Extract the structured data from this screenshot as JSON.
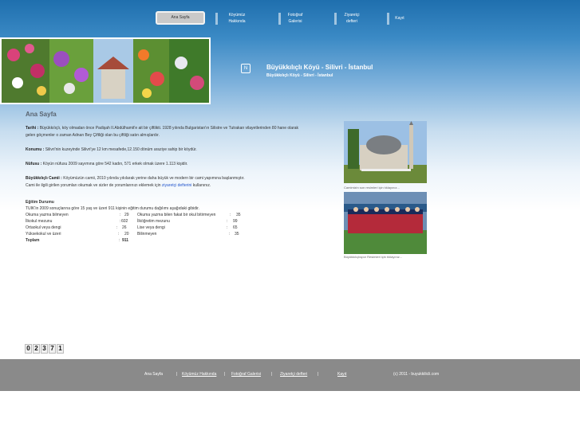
{
  "nav": {
    "items": [
      {
        "label": "Ana Sayfa"
      },
      {
        "label": "Köyümüz Hakkında"
      },
      {
        "label": "Fotoğraf Galerisi"
      },
      {
        "label": "Ziyaretçi defteri"
      },
      {
        "label": "Kayıt"
      }
    ]
  },
  "header": {
    "title": "Büyükkılıçlı Köyü - Silivri - İstanbul",
    "subtitle": "Büyükkılıçlı Köyü - Silivri - İstanbul",
    "icon": "site-icon"
  },
  "main": {
    "page_title": "Ana Sayfa",
    "sections": [
      {
        "label": "Tarihi :",
        "text": "Büyükkılıçlı, köy olmadan önce Padişah II.Abdülhamit'e ait bir çiftlikti. 1928 yılında Bulgaristan'ın Silistre ve Tutrakan vilayetlerinden 80 hane olarak gelen göçmenler o zaman Adnan Bey Çiftliği olan bu çiftliği satın almışlardır."
      },
      {
        "label": "Konumu :",
        "text": "Silivri'nin kuzeyinde Silivri'ye 12 km mesafede,12.150 dönüm araziye sahip bir köydür."
      },
      {
        "label": "Nüfusu :",
        "text": "Köyün nüfusu 2009 sayımına göre 542 kadın, 571 erkek olmak üzere 1.113 kişidir."
      },
      {
        "label": "Büyükkılıçlı Camii :",
        "text": "Köyümüzün camii, 2010 yılında yıkılarak yerine daha büyük ve modern bir cami yapımına başlanmıştır.",
        "text2": "Cami ile ilgili girilen yorumları okumak ve sizler de yorumlarınızı eklemek için",
        "link": "ziyaretçi defterini",
        "text3": "kullanınız."
      }
    ],
    "education": {
      "title": "Eğitim Durumu",
      "intro": "TUIK'in 2009 sonuçlarına göre 15 yaş ve üzeri 911 kişinin eğitim durumu dağılımı aşağıdaki gibidir.",
      "left": [
        {
          "label": "Okuma yazma bilmeyen",
          "value": "29"
        },
        {
          "label": "İlkokul mezunu",
          "value": "602"
        },
        {
          "label": "Ortaokul veya dengi",
          "value": "26"
        },
        {
          "label": "Yüksekokul ve üzeri",
          "value": "20"
        },
        {
          "label": "Toplam",
          "value": "911"
        }
      ],
      "right": [
        {
          "label": "Okuma yazma bilen fakat bir okul bitirmeyen",
          "value": "35"
        },
        {
          "label": "İlköğretim mezunu",
          "value": "99"
        },
        {
          "label": "Lise veya dengi",
          "value": "65"
        },
        {
          "label": "Bilinmeyen",
          "value": "35"
        }
      ]
    }
  },
  "sidebar": {
    "photo1_caption": "Camimizin son resimleri için tıklayınız...",
    "photo2_caption": "Büyükkılıçlıspor Resimleri için tıklayınız..."
  },
  "counter": {
    "digits": [
      "0",
      "2",
      "3",
      "7",
      "1"
    ]
  },
  "footer": {
    "links": [
      "Ana Sayfa",
      "Köyümüz Hakkında",
      "Fotoğraf Galerisi",
      "Ziyaretçi defteri",
      "Kayıt"
    ],
    "separator": "|",
    "copyright": "(c) 2011 - buyukkilicli.com"
  }
}
